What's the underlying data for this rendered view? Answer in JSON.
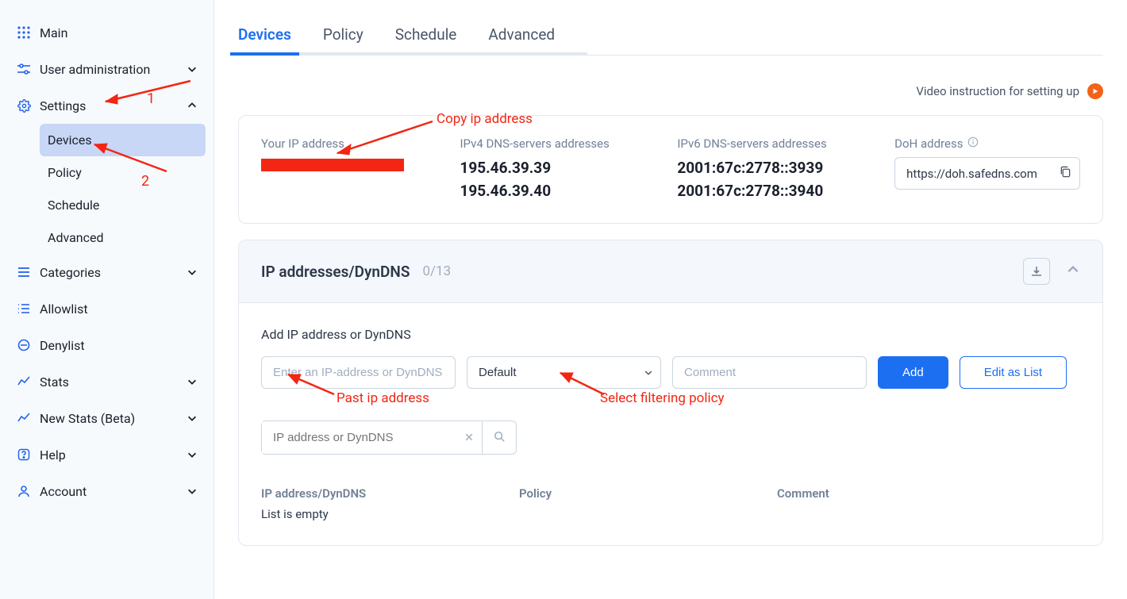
{
  "sidebar": {
    "main": "Main",
    "user_admin": "User administration",
    "settings": "Settings",
    "settings_children": {
      "devices": "Devices",
      "policy": "Policy",
      "schedule": "Schedule",
      "advanced": "Advanced"
    },
    "categories": "Categories",
    "allowlist": "Allowlist",
    "denylist": "Denylist",
    "stats": "Stats",
    "new_stats": "New Stats (Beta)",
    "help": "Help",
    "account": "Account"
  },
  "tabs": {
    "devices": "Devices",
    "policy": "Policy",
    "schedule": "Schedule",
    "advanced": "Advanced"
  },
  "video_link": "Video instruction for setting up",
  "ip_info": {
    "your_ip_label": "Your IP address",
    "ipv4_label": "IPv4 DNS-servers addresses",
    "ipv4_1": "195.46.39.39",
    "ipv4_2": "195.46.39.40",
    "ipv6_label": "IPv6 DNS-servers addresses",
    "ipv6_1": "2001:67c:2778::3939",
    "ipv6_2": "2001:67c:2778::3940",
    "doh_label": "DoH address",
    "doh_value": "https://doh.safedns.com"
  },
  "section": {
    "title": "IP addresses/DynDNS",
    "count": "0/13",
    "add_label": "Add IP address or DynDNS",
    "ip_placeholder": "Enter an IP-address or DynDNS",
    "policy_selected": "Default",
    "comment_placeholder": "Comment",
    "add_btn": "Add",
    "edit_btn": "Edit as List",
    "search_placeholder": "IP address or DynDNS",
    "col_ip": "IP address/DynDNS",
    "col_policy": "Policy",
    "col_comment": "Comment",
    "empty": "List is empty"
  },
  "annotations": {
    "a1": "1",
    "a2": "2",
    "copy": "Copy ip address",
    "past": "Past ip address",
    "select": "Select filtering policy"
  }
}
